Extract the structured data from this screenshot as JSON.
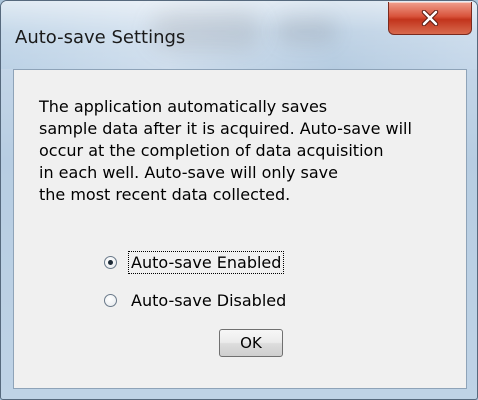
{
  "window": {
    "title": "Auto-save Settings",
    "close_icon": "close-x-icon"
  },
  "message": {
    "lines": [
      "The application automatically saves",
      "sample data after it is acquired. Auto-save will",
      "occur at the completion of data acquisition",
      "in each well. Auto-save will only save",
      "the most recent data collected."
    ]
  },
  "options": {
    "enabled_label": "Auto-save Enabled",
    "disabled_label": "Auto-save Disabled",
    "selected": "Auto-save Enabled"
  },
  "buttons": {
    "ok_label": "OK"
  },
  "colors": {
    "close_button": "#c2341c",
    "dialog_background": "#f0f0f0"
  }
}
